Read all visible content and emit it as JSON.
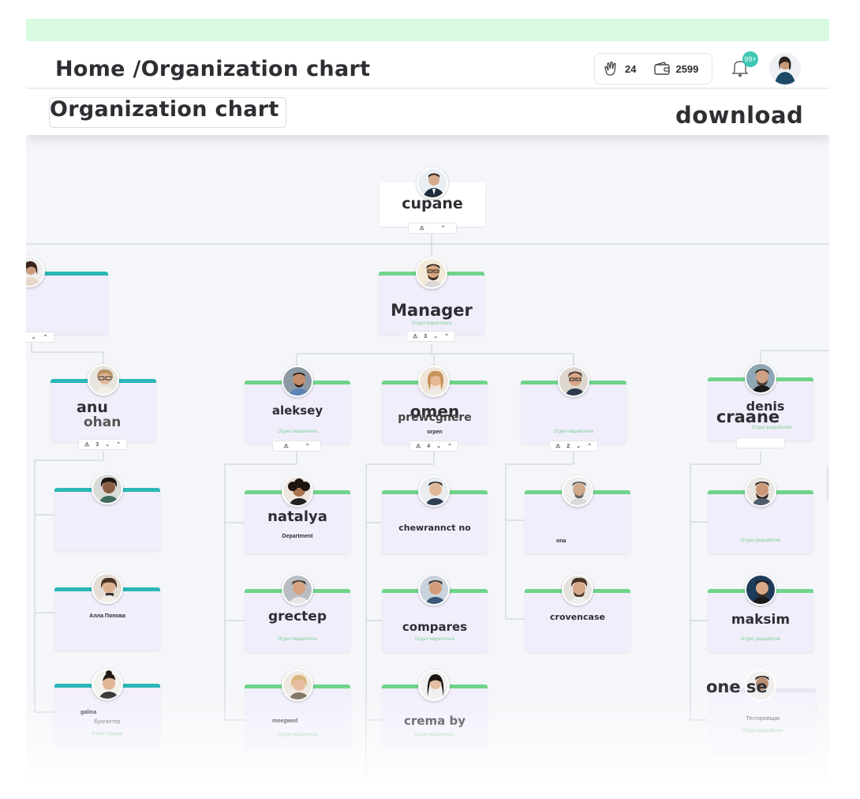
{
  "header": {
    "breadcrumb": "Home /Organization chart",
    "claps": "24",
    "wallet": "2599",
    "notifications": "99+"
  },
  "subheader": {
    "title": "Organization chart",
    "download": "download"
  },
  "chart": {
    "root": {
      "name": "cupane"
    },
    "manager": {
      "name": "Manager",
      "sub": "Отдел маркетинга",
      "count": "3"
    },
    "left": {
      "name1": "anu",
      "name2": "ohan",
      "count": "3",
      "kids": [
        "Алла Попова",
        "galina"
      ],
      "kid_sub": "Бухгалтер",
      "kid_dept": "Отдел продаж"
    },
    "aleksey": {
      "name": "aleksey",
      "sub": "Отдел маркетинга",
      "kids": [
        "natalya",
        "grectep",
        "moegwed"
      ],
      "natalya_sub": "Department"
    },
    "omen": {
      "name": "omen",
      "name2": "prewcgnere",
      "small": "orpen",
      "count": "4",
      "kids": [
        "chewrannct no",
        "compares",
        "crema by"
      ]
    },
    "third": {
      "sub": "Отдел маркетинга",
      "count": "2",
      "kids": [
        "ona",
        "crovencase"
      ]
    },
    "denis": {
      "name": "denis",
      "name2": "craane",
      "sub": "Отдел разработки",
      "kids": [
        "maksim",
        "one se"
      ],
      "kid_sub": "Тестировщик"
    }
  }
}
